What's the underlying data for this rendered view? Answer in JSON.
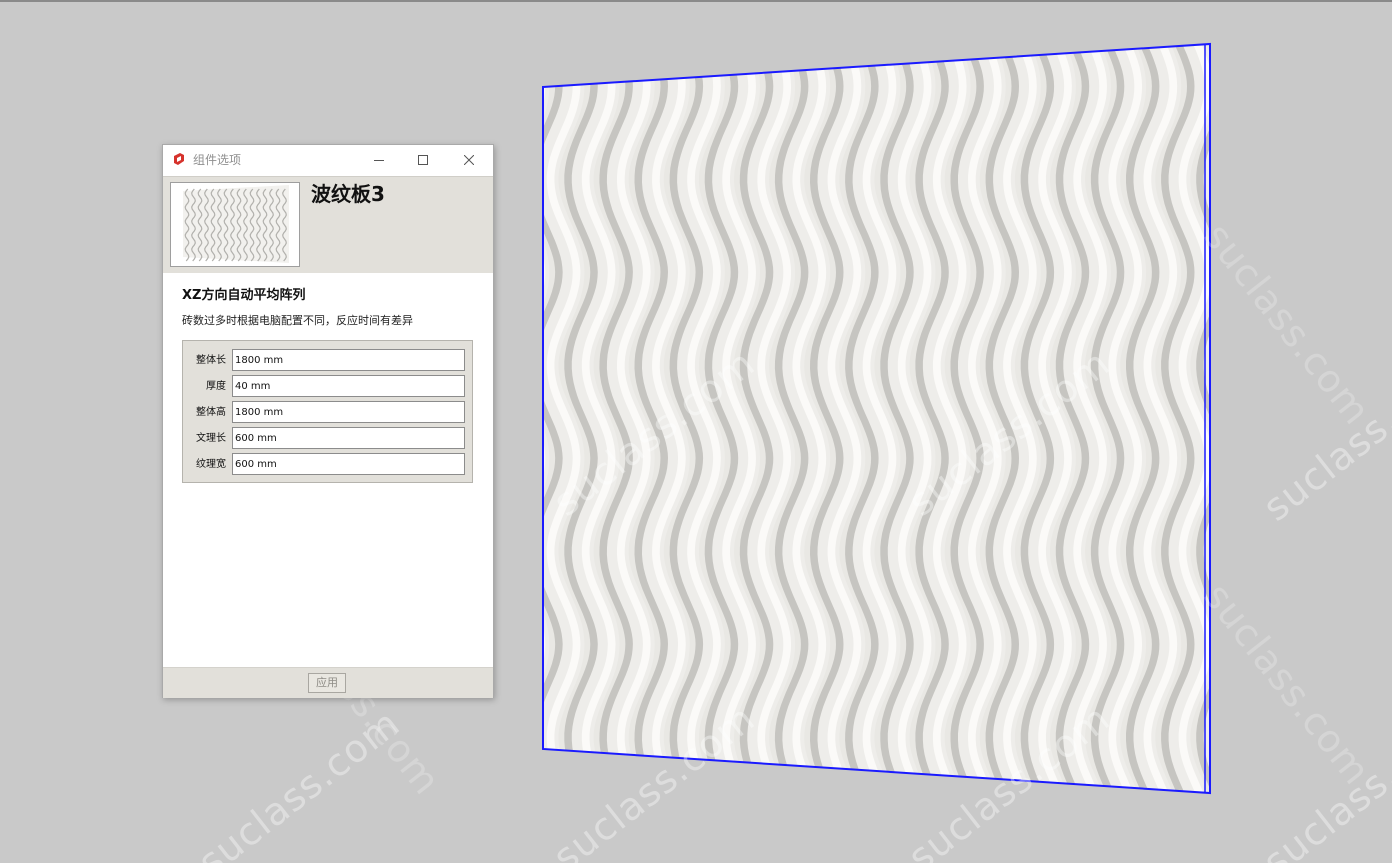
{
  "dialog": {
    "window_title": "组件选项",
    "component_name": "波纹板3",
    "section_title": "XZ方向自动平均阵列",
    "section_desc": "砖数过多时根据电脑配置不同，反应时间有差异",
    "fields": [
      {
        "label": "整体长",
        "value": "1800 mm"
      },
      {
        "label": "厚度",
        "value": "40 mm"
      },
      {
        "label": "整体高",
        "value": "1800 mm"
      },
      {
        "label": "文理长",
        "value": "600 mm"
      },
      {
        "label": "纹理宽",
        "value": "600 mm"
      }
    ],
    "apply_label": "应用"
  },
  "watermark": {
    "text": "suclass.com"
  },
  "colors": {
    "viewport_bg": "#c9c9c9",
    "selection_outline": "#1a1aff",
    "panel_face": "#e9e8e4",
    "dialog_chrome": "#e2e0da",
    "app_icon_red": "#d6322c"
  },
  "icons": {
    "app": "sketchup-logo-icon",
    "minimize": "minimize-icon",
    "maximize": "maximize-icon",
    "close": "close-icon"
  }
}
